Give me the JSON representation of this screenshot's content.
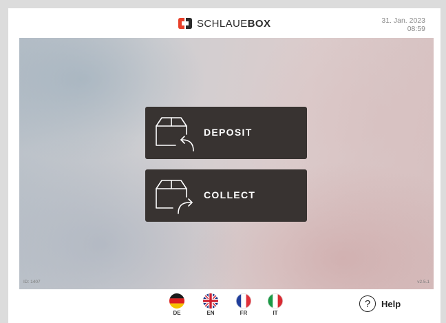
{
  "header": {
    "logo_light": "SCHLAUE",
    "logo_bold": "BOX",
    "date": "31. Jan. 2023",
    "time": "08:59"
  },
  "hero": {
    "id_text": "ID: 1407",
    "version": "v2.5.1"
  },
  "actions": [
    {
      "label": "DEPOSIT",
      "icon": "box-return-arrow-icon"
    },
    {
      "label": "COLLECT",
      "icon": "box-forward-arrow-icon"
    }
  ],
  "languages": [
    {
      "code": "DE",
      "icon": "germany-flag-icon"
    },
    {
      "code": "EN",
      "icon": "uk-flag-icon"
    },
    {
      "code": "FR",
      "icon": "france-flag-icon"
    },
    {
      "code": "IT",
      "icon": "italy-flag-icon"
    }
  ],
  "help": {
    "label": "Help",
    "glyph": "?"
  },
  "colors": {
    "brand_red": "#e8402a",
    "button_bg": "#383331",
    "button_text": "#ffffff"
  }
}
